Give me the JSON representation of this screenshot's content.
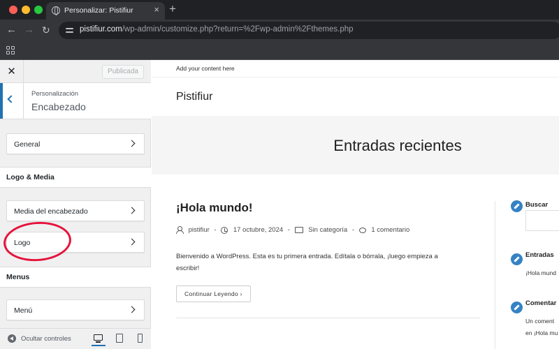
{
  "browser": {
    "tab_title": "Personalizar: Pistifiur",
    "tab_close": "×",
    "new_tab": "+",
    "url_host": "pistifiur.com",
    "url_path": "/wp-admin/customize.php?return=%2Fwp-admin%2Fthemes.php"
  },
  "sidebar": {
    "close_glyph": "✕",
    "publish_label": "Publicada",
    "breadcrumb": "Personalización",
    "section_title": "Encabezado",
    "controls": [
      {
        "label": "General"
      },
      {
        "label": "Media del encabezado"
      },
      {
        "label": "Logo"
      },
      {
        "label": "Menú"
      }
    ],
    "groups": [
      {
        "label": "Logo & Media"
      },
      {
        "label": "Menus"
      }
    ],
    "footer": {
      "collapse_label": "Ocultar controles"
    }
  },
  "preview": {
    "topbar_text": "Add your content here",
    "site_title": "Pistifiur",
    "hero_title": "Entradas recientes",
    "post": {
      "title": "¡Hola mundo!",
      "author": "pistifiur",
      "date": "17 octubre, 2024",
      "category": "Sin categoría",
      "comments": "1 comentario",
      "separator": "-",
      "excerpt": "Bienvenido a WordPress. Esta es tu primera entrada. Edítala o bórrala, ¡luego empieza a escribir!",
      "read_more": "Continuar Leyendo"
    },
    "widgets": {
      "search_title": "Buscar",
      "recent_posts_title": "Entradas",
      "recent_posts_item": "¡Hola mund",
      "comments_title": "Comentar",
      "comments_line1": "Un coment",
      "comments_line2": "en ¡Hola mu"
    }
  },
  "colors": {
    "accent": "#2271b1",
    "highlight_circle": "#e5133b",
    "widget_icon": "#3582c4"
  }
}
